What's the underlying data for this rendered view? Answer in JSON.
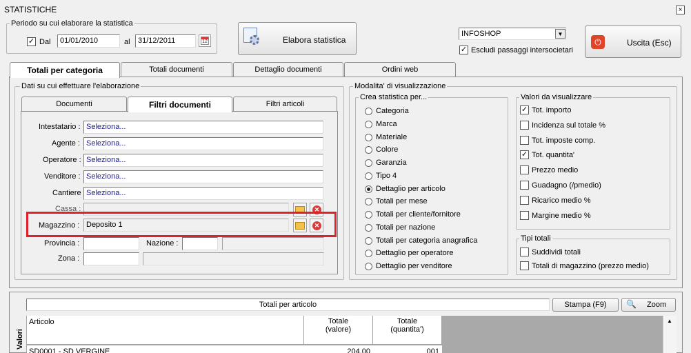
{
  "window": {
    "title": "STATISTICHE"
  },
  "period": {
    "legend": "Periodo su cui elaborare la statistica",
    "dal_label": "Dal",
    "dal_checked": true,
    "dal_value": "01/01/2010",
    "al_label": "al",
    "al_value": "31/12/2011",
    "calendar_icon_text": "12"
  },
  "toolbar": {
    "elabora_label": "Elabora statistica",
    "shop_value": "INFOSHOP",
    "escludi_label": "Escludi passaggi intersocietari",
    "escludi_checked": true,
    "uscita_label": "Uscita (Esc)"
  },
  "main_tabs": [
    {
      "label": "Totali per categoria",
      "active": true
    },
    {
      "label": "Totali documenti"
    },
    {
      "label": "Dettaglio documenti"
    },
    {
      "label": "Ordini web"
    }
  ],
  "dati": {
    "legend": "Dati su cui effettuare l'elaborazione",
    "tabs": [
      {
        "label": "Documenti"
      },
      {
        "label": "Filtri documenti",
        "active": true
      },
      {
        "label": "Filtri articoli"
      }
    ],
    "fields": [
      {
        "label": "Intestatario :",
        "value": "Seleziona..."
      },
      {
        "label": "Agente :",
        "value": "Seleziona..."
      },
      {
        "label": "Operatore :",
        "value": "Seleziona..."
      },
      {
        "label": "Venditore :",
        "value": "Seleziona..."
      },
      {
        "label": "Cantiere :",
        "value": "Seleziona..."
      }
    ],
    "cassa_label": "Cassa :",
    "magazzino_label": "Magazzino :",
    "magazzino_value": "Deposito 1",
    "provincia_label": "Provincia :",
    "nazione_label": "Nazione :",
    "zona_label": "Zona :"
  },
  "modalita": {
    "legend": "Modalita' di visualizzazione",
    "crea_legend": "Crea statistica per...",
    "options": [
      "Categoria",
      "Marca",
      "Materiale",
      "Colore",
      "Garanzia",
      "Tipo 4",
      "Dettaglio per articolo",
      "Totali per mese",
      "Totali per cliente/fornitore",
      "Totali per nazione",
      "Totali per categoria anagrafica",
      "Dettaglio per operatore",
      "Dettaglio per venditore"
    ],
    "selected_option": "Dettaglio per articolo",
    "valori_legend": "Valori da visualizzare",
    "valori": [
      {
        "label": "Tot. importo",
        "checked": true
      },
      {
        "label": "Incidenza sul totale %",
        "checked": false
      },
      {
        "label": "Tot. imposte comp.",
        "checked": false
      },
      {
        "label": "Tot. quantita'",
        "checked": true
      },
      {
        "label": "Prezzo medio",
        "checked": false
      },
      {
        "label": "Guadagno (/pmedio)",
        "checked": false
      },
      {
        "label": "Ricarico medio %",
        "checked": false
      },
      {
        "label": "Margine medio %",
        "checked": false
      }
    ],
    "tipi_legend": "Tipi totali",
    "tipi": [
      {
        "label": "Suddividi totali",
        "checked": false
      },
      {
        "label": "Totali di magazzino (prezzo medio)",
        "checked": false
      }
    ]
  },
  "results": {
    "title": "Totali per articolo",
    "stampa_label": "Stampa (F9)",
    "zoom_label": "Zoom",
    "side_label": "Valori",
    "columns": [
      "Articolo",
      "Totale\n(valore)",
      "Totale\n(quantita')"
    ],
    "rows": [
      {
        "articolo": "SD0001 - SD VERGINE",
        "valore": "204,00",
        "quantita": "001"
      }
    ]
  },
  "colors": {
    "highlight_box": "#e0202a",
    "exit_icon": "#e0452a"
  }
}
